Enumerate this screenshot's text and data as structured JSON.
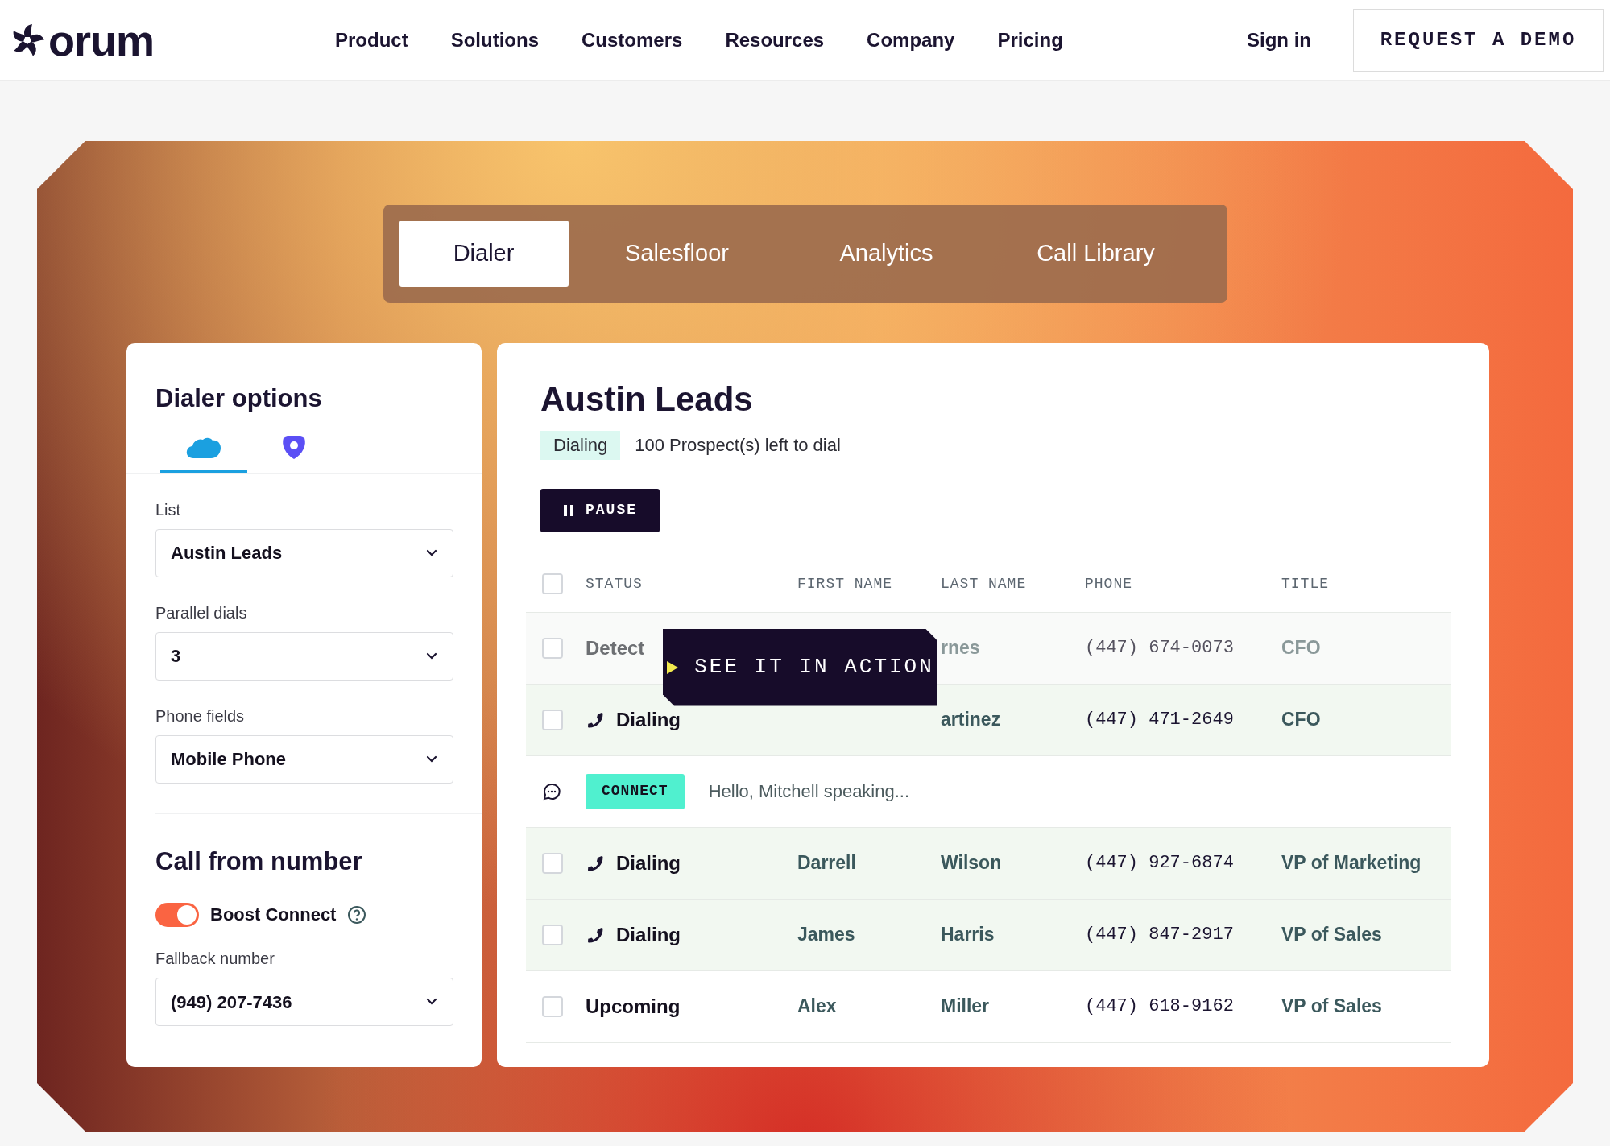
{
  "header": {
    "logo": "orum",
    "nav": [
      "Product",
      "Solutions",
      "Customers",
      "Resources",
      "Company",
      "Pricing"
    ],
    "sign_in": "Sign in",
    "cta": "REQUEST A DEMO"
  },
  "tabs": [
    {
      "label": "Dialer",
      "selected": true
    },
    {
      "label": "Salesfloor",
      "selected": false
    },
    {
      "label": "Analytics",
      "selected": false
    },
    {
      "label": "Call Library",
      "selected": false
    }
  ],
  "dialer_options": {
    "title": "Dialer options",
    "integrations": [
      {
        "kind": "cloud",
        "selected": true
      },
      {
        "kind": "shield",
        "selected": false
      }
    ],
    "fields": [
      {
        "label": "List",
        "value": "Austin Leads"
      },
      {
        "label": "Parallel dials",
        "value": "3"
      },
      {
        "label": "Phone fields",
        "value": "Mobile Phone"
      }
    ],
    "call_from": {
      "title": "Call from number",
      "toggle": {
        "label": "Boost Connect",
        "on": true
      },
      "fallback": {
        "label": "Fallback number",
        "value": "(949) 207-7436"
      }
    }
  },
  "list": {
    "title": "Austin Leads",
    "status_badge": "Dialing",
    "remaining": "100 Prospect(s) left to dial",
    "pause": "PAUSE",
    "select_all": {
      "checked": false
    },
    "columns": [
      "STATUS",
      "FIRST NAME",
      "LAST NAME",
      "PHONE",
      "TITLE"
    ],
    "rows": [
      {
        "kind": "prospect",
        "checked": false,
        "calling": false,
        "muted": true,
        "status": "Detect",
        "last_name": "rnes",
        "phone": "(447) 674-0073",
        "title": "CFO"
      },
      {
        "kind": "prospect",
        "checked": false,
        "calling": true,
        "muted": false,
        "status": "Dialing",
        "last_name": "artinez",
        "phone": "(447) 471-2649",
        "title": "CFO"
      },
      {
        "kind": "transcript",
        "tag": "CONNECT",
        "text": "Hello, Mitchell speaking..."
      },
      {
        "kind": "prospect",
        "checked": false,
        "calling": true,
        "muted": false,
        "status": "Dialing",
        "first_name": "Darrell",
        "last_name": "Wilson",
        "phone": "(447) 927-6874",
        "title": "VP of Marketing"
      },
      {
        "kind": "prospect",
        "checked": false,
        "calling": true,
        "muted": false,
        "status": "Dialing",
        "first_name": "James",
        "last_name": "Harris",
        "phone": "(447) 847-2917",
        "title": "VP of Sales"
      },
      {
        "kind": "prospect",
        "checked": false,
        "calling": false,
        "muted": false,
        "status": "Upcoming",
        "first_name": "Alex",
        "last_name": "Miller",
        "phone": "(447) 618-9162",
        "title": "VP of Sales"
      }
    ]
  },
  "overlay": {
    "label": "SEE IT IN ACTION"
  }
}
